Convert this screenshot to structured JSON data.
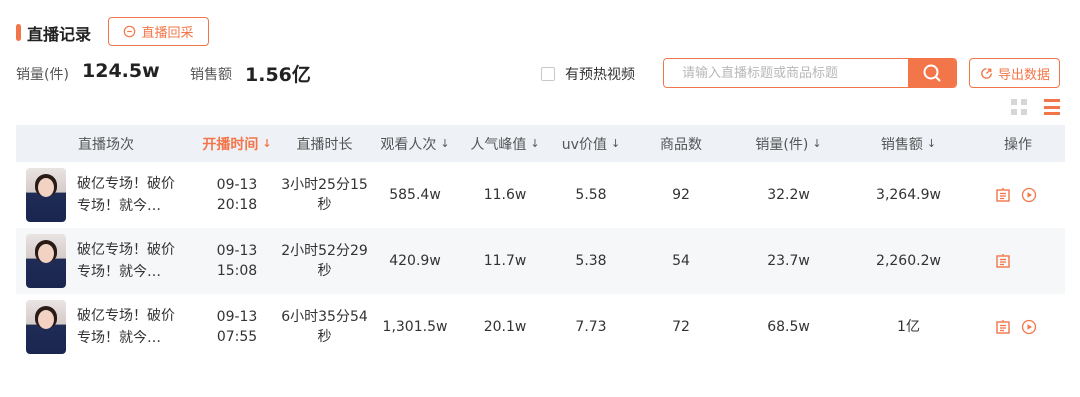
{
  "header": {
    "title": "直播记录",
    "replay_label": "直播回采"
  },
  "stats": {
    "sales_label": "销量(件)",
    "sales_value": "124.5w",
    "revenue_label": "销售额",
    "revenue_value": "1.56亿"
  },
  "filters": {
    "preheat_label": "有预热视频",
    "search_placeholder": "请输入直播标题或商品标题",
    "export_label": "导出数据"
  },
  "table": {
    "columns": [
      {
        "label": "直播场次",
        "sort": ""
      },
      {
        "label": "开播时间",
        "sort": "↓"
      },
      {
        "label": "直播时长",
        "sort": ""
      },
      {
        "label": "观看人次",
        "sort": "↓"
      },
      {
        "label": "人气峰值",
        "sort": "↓"
      },
      {
        "label": "uv价值",
        "sort": "↓"
      },
      {
        "label": "商品数",
        "sort": ""
      },
      {
        "label": "销量(件)",
        "sort": "↓"
      },
      {
        "label": "销售额",
        "sort": "↓"
      },
      {
        "label": "操作",
        "sort": ""
      }
    ],
    "rows": [
      {
        "title_line1": "破亿专场！破价",
        "title_line2": "专场！就今…",
        "date": "09-13",
        "time": "20:18",
        "duration_line1": "3小时25分15",
        "duration_line2": "秒",
        "views": "585.4w",
        "peak": "11.6w",
        "uv": "5.58",
        "products": "92",
        "sales": "32.2w",
        "revenue": "3,264.9w"
      },
      {
        "title_line1": "破亿专场！破价",
        "title_line2": "专场！就今…",
        "date": "09-13",
        "time": "15:08",
        "duration_line1": "2小时52分29",
        "duration_line2": "秒",
        "views": "420.9w",
        "peak": "11.7w",
        "uv": "5.38",
        "products": "54",
        "sales": "23.7w",
        "revenue": "2,260.2w"
      },
      {
        "title_line1": "破亿专场！破价",
        "title_line2": "专场！就今…",
        "date": "09-13",
        "time": "07:55",
        "duration_line1": "6小时35分54",
        "duration_line2": "秒",
        "views": "1,301.5w",
        "peak": "20.1w",
        "uv": "7.73",
        "products": "72",
        "sales": "68.5w",
        "revenue": "1亿"
      }
    ]
  },
  "colors": {
    "accent": "#f3764a",
    "header_bg": "#eef2f7",
    "alt_row_bg": "#f6f7f9"
  },
  "icons": [
    "replay-icon",
    "search-icon",
    "export-icon",
    "grid-view-icon",
    "list-view-icon",
    "detail-icon",
    "play-icon"
  ]
}
